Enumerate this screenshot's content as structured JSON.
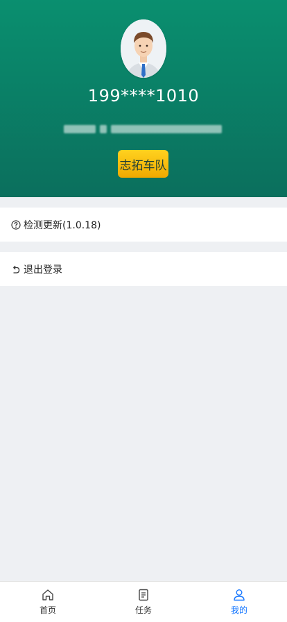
{
  "profile": {
    "phone": "199****1010",
    "team_badge": "志拓车队"
  },
  "menu": {
    "update_label": "检测更新(1.0.18)",
    "logout_label": "退出登录"
  },
  "tabs": [
    {
      "label": "首页",
      "icon": "home-icon",
      "active": false
    },
    {
      "label": "任务",
      "icon": "document-icon",
      "active": false
    },
    {
      "label": "我的",
      "icon": "user-icon",
      "active": true
    }
  ],
  "colors": {
    "header_green": "#0b7f63",
    "badge_yellow": "#f6bd08",
    "active_blue": "#1677ff",
    "background": "#eef0f3"
  }
}
